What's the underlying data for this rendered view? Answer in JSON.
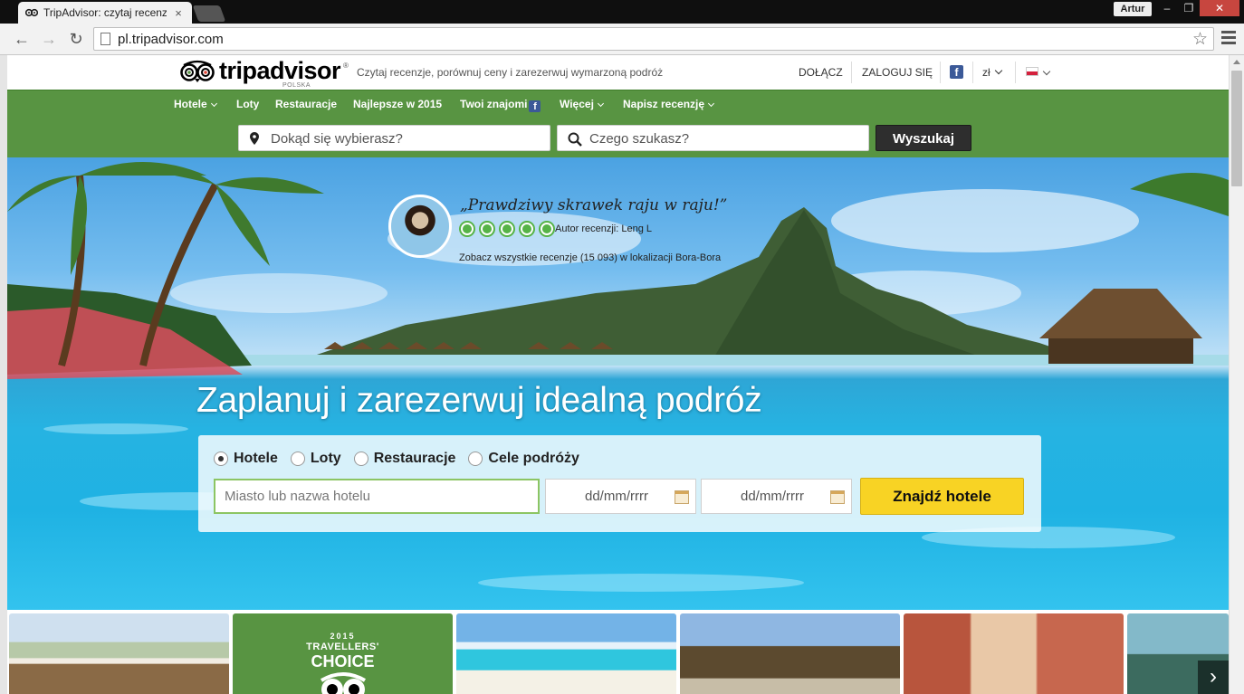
{
  "browser": {
    "tab_title": "TripAdvisor: czytaj recenzje",
    "tab_close": "×",
    "user": "Artur",
    "window_buttons": {
      "minimize": "‒",
      "maximize": "❐",
      "close": "✕"
    },
    "back": "←",
    "forward": "→",
    "reload": "↻",
    "url": "pl.tripadvisor.com",
    "star": "☆"
  },
  "header": {
    "logo_text": "tripadvisor",
    "logo_country": "POLSKA",
    "logo_reg": "®",
    "tagline": "Czytaj recenzje, porównuj ceny i zarezerwuj wymarzoną podróż",
    "join": "DOŁĄCZ",
    "login": "ZALOGUJ SIĘ",
    "facebook": "f",
    "currency": "zł"
  },
  "nav": {
    "items": [
      "Hotele",
      "Loty",
      "Restauracje",
      "Najlepsze w 2015",
      "Twoi znajomi",
      "Więcej",
      "Napisz recenzję"
    ],
    "fb": "f"
  },
  "search": {
    "where_placeholder": "Dokąd się wybierasz?",
    "what_placeholder": "Czego szukasz?",
    "button": "Wyszukaj"
  },
  "hero": {
    "review_quote": "„Prawdziwy skrawek raju w raju!”",
    "review_rating": 5,
    "review_author": "Autor recenzji: Leng L",
    "review_link": "Zobacz wszystkie recenzje (15 093) w lokalizacji Bora-Bora",
    "title": "Zaplanuj i zarezerwuj idealną podróż"
  },
  "booking": {
    "options": [
      "Hotele",
      "Loty",
      "Restauracje",
      "Cele podróży"
    ],
    "selected": "Hotele",
    "city_placeholder": "Miasto lub nazwa hotelu",
    "checkin_placeholder": "dd/mm/rrrr",
    "checkout_placeholder": "dd/mm/rrrr",
    "button": "Znajdź hotele"
  },
  "tiles": {
    "travellers_choice": {
      "year": "2015",
      "line1": "TRAVELLERS'",
      "line2": "CHOICE"
    },
    "next": "›"
  },
  "colors": {
    "nav_green": "#589442",
    "button_yellow": "#f8d324",
    "rating_green": "#56b347"
  }
}
